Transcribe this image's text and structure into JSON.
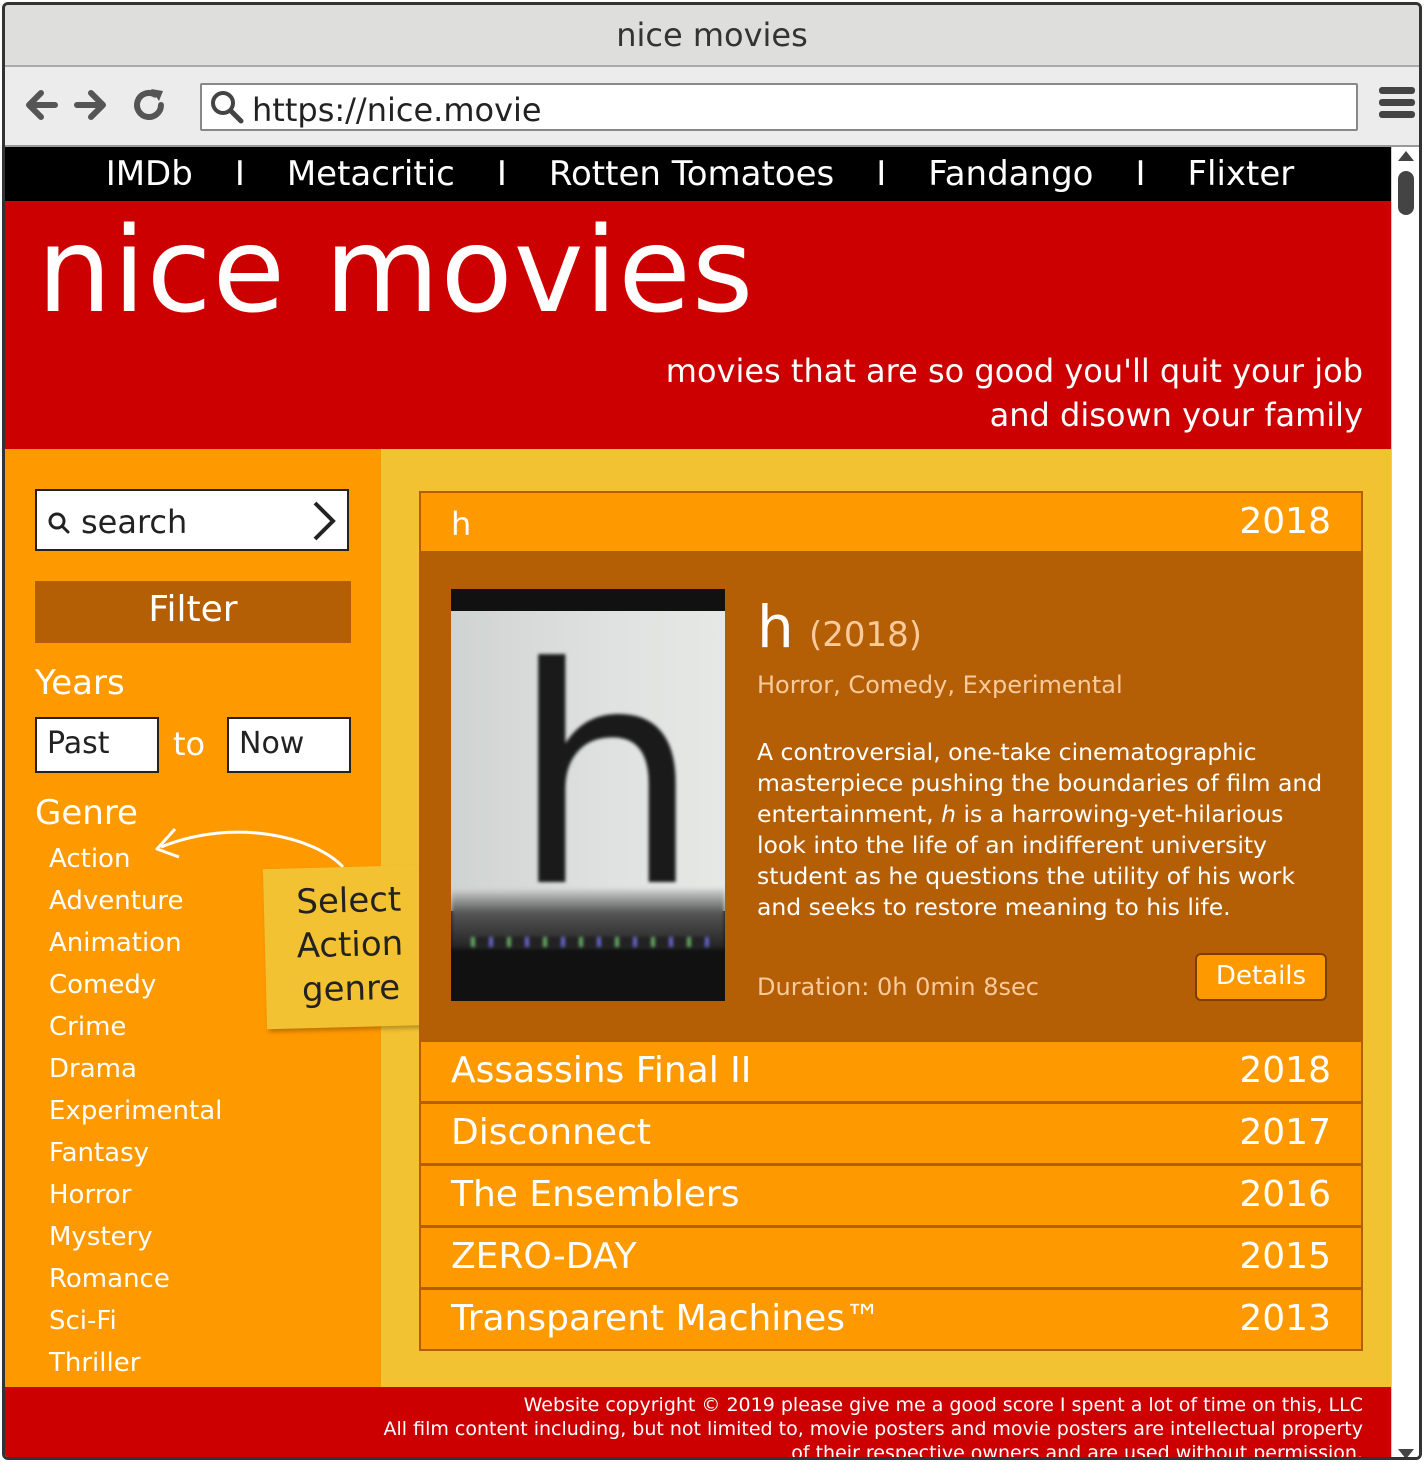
{
  "window": {
    "title": "nice movies"
  },
  "browser": {
    "url": "https://nice.movie"
  },
  "topnav": {
    "links": [
      "IMDb",
      "Metacritic",
      "Rotten Tomatoes",
      "Fandango",
      "Flixter"
    ],
    "separator": "I"
  },
  "header": {
    "brand": "nice movies",
    "tagline_line1": "movies that are so good you'll quit your job",
    "tagline_line2": "and disown your family"
  },
  "sidebar": {
    "search_placeholder": "search",
    "filter_label": "Filter",
    "years_label": "Years",
    "year_from": "Past",
    "to_label": "to",
    "year_to": "Now",
    "genre_label": "Genre",
    "genres": [
      "Action",
      "Adventure",
      "Animation",
      "Comedy",
      "Crime",
      "Drama",
      "Experimental",
      "Fantasy",
      "Horror",
      "Mystery",
      "Romance",
      "Sci-Fi",
      "Thriller"
    ],
    "annotation_line1": "Select",
    "annotation_line2": "Action",
    "annotation_line3": "genre"
  },
  "movies": {
    "selected": {
      "row_title": "h",
      "row_year": "2018",
      "title": "h",
      "year": "(2018)",
      "genres": "Horror, Comedy, Experimental",
      "description_before": "A controversial, one-take cinematographic masterpiece pushing the boundaries of film and entertainment, ",
      "description_italic": "h",
      "description_after": " is a harrowing-yet-hilarious look into the life of an indifferent university student as he questions the utility of his work and seeks to restore meaning to his life.",
      "duration": "Duration: 0h 0min 8sec",
      "details_label": "Details",
      "poster_letter": "h"
    },
    "list": [
      {
        "title": "Assassins Final II",
        "year": "2018"
      },
      {
        "title": "Disconnect",
        "year": "2017"
      },
      {
        "title": "The Ensemblers",
        "year": "2016"
      },
      {
        "title": "ZERO-DAY",
        "year": "2015"
      },
      {
        "title": "Transparent Machines™",
        "year": "2013"
      }
    ]
  },
  "footer": {
    "line1": "Website copyright © 2019 please give me a good score I spent a lot of time on this, LLC",
    "line2": "All film content including, but not limited to, movie posters and movie posters are intellectual property",
    "line3": "of their respective owners and are used without permission."
  },
  "colors": {
    "red": "#cc0000",
    "orange": "#ff9900",
    "dark_orange": "#b45f06",
    "yellow": "#f3c232",
    "peach": "#f9cb9c"
  },
  "icons": [
    "back-arrow-icon",
    "forward-arrow-icon",
    "reload-icon",
    "search-icon",
    "menu-icon",
    "chevron-right-icon"
  ]
}
